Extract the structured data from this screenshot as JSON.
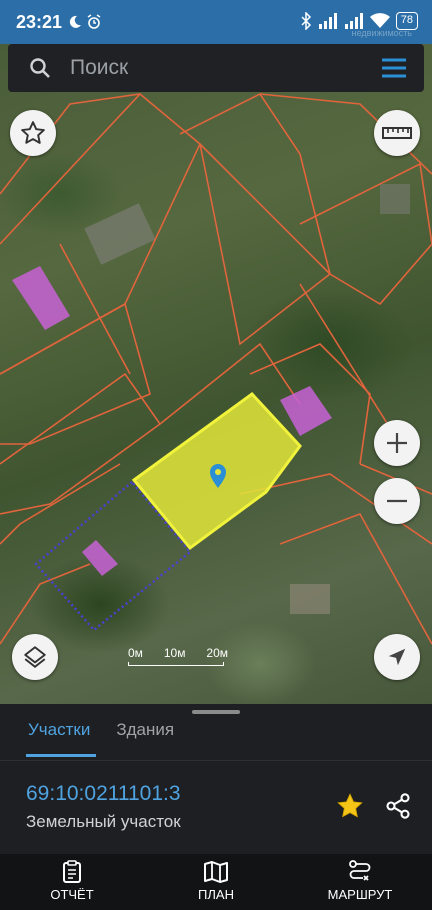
{
  "status_bar": {
    "time": "23:21",
    "battery": "78"
  },
  "search": {
    "placeholder": "Поиск"
  },
  "watermark": "недвижимость",
  "map": {
    "scale_labels": [
      "0м",
      "10м",
      "20м"
    ],
    "colors": {
      "parcel_border": "#e0643c",
      "selected_fill": "#e3e63a",
      "building_fill": "#c862d6",
      "pin": "#2b8fd6"
    }
  },
  "sheet": {
    "tabs": [
      {
        "label": "Участки",
        "active": true
      },
      {
        "label": "Здания",
        "active": false
      }
    ],
    "cadastral_number": "69:10:0211101:3",
    "parcel_type": "Земельный участок"
  },
  "bottom_nav": [
    {
      "label": "ОТЧЁТ",
      "icon": "report-icon"
    },
    {
      "label": "ПЛАН",
      "icon": "map-plan-icon"
    },
    {
      "label": "МАРШРУТ",
      "icon": "route-icon"
    }
  ]
}
